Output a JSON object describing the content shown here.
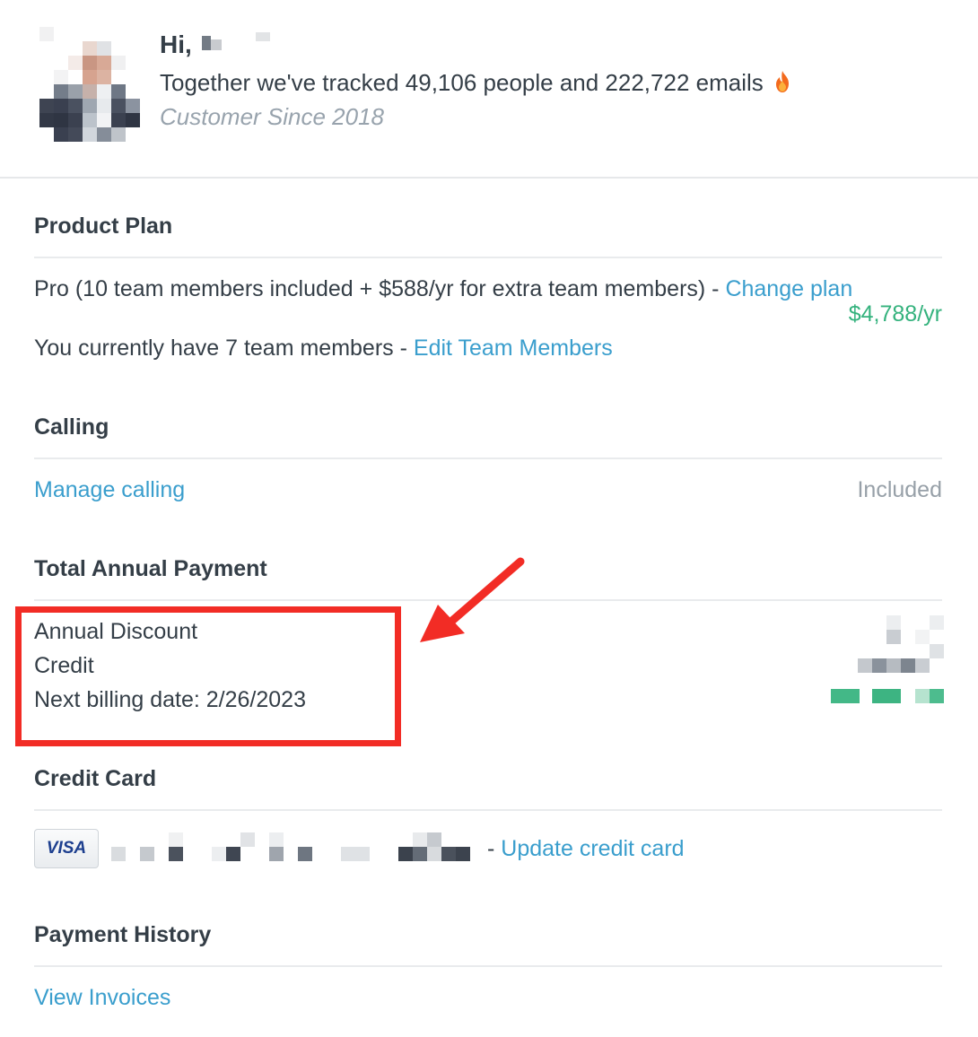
{
  "header": {
    "greeting": "Hi,",
    "tracked_text": "Together we've tracked 49,106 people and 222,722 emails",
    "fire_icon": "fire-emoji",
    "customer_since": "Customer Since 2018"
  },
  "product_plan": {
    "title": "Product Plan",
    "plan_description": "Pro (10 team members included + $588/yr for extra team members) - ",
    "change_plan_link": "Change plan",
    "price": "$4,788/yr",
    "team_text": "You currently have 7 team members - ",
    "edit_team_link": "Edit Team Members"
  },
  "calling": {
    "title": "Calling",
    "manage_link": "Manage calling",
    "status": "Included"
  },
  "total_annual_payment": {
    "title": "Total Annual Payment",
    "lines": [
      "Annual Discount",
      "Credit",
      "Next billing date: 2/26/2023"
    ]
  },
  "credit_card": {
    "title": "Credit Card",
    "card_brand": "VISA",
    "separator": "- ",
    "update_link": "Update credit card"
  },
  "payment_history": {
    "title": "Payment History",
    "view_link": "View Invoices"
  },
  "colors": {
    "text": "#343e47",
    "link": "#3a9ecd",
    "muted": "#97a0a8",
    "price_green": "#34b27d",
    "highlight_red": "#f22c25"
  }
}
